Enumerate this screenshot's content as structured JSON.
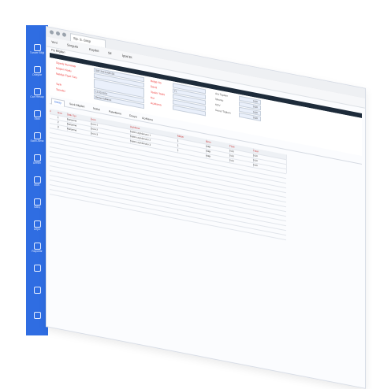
{
  "sidebar": {
    "items": [
      {
        "label": "Tuncer Bilgi",
        "icon": "home-icon"
      },
      {
        "label": "Onaylar",
        "icon": "tools-icon"
      },
      {
        "label": "Cari Hesap",
        "icon": "building-icon"
      },
      {
        "label": "Stok",
        "icon": "box-icon"
      },
      {
        "label": "Satın Alma",
        "icon": "cart-icon"
      },
      {
        "label": "Üretim",
        "icon": "gear-icon"
      },
      {
        "label": "Muh.",
        "icon": "doc-icon"
      },
      {
        "label": "Satış",
        "icon": "store-icon"
      },
      {
        "label": "Depo",
        "icon": "warehouse-icon"
      },
      {
        "label": "Raporlar",
        "icon": "chart-icon"
      },
      {
        "label": "",
        "icon": "truck-icon"
      },
      {
        "label": "",
        "icon": "car-icon"
      },
      {
        "label": "",
        "icon": "lock-icon"
      }
    ]
  },
  "window": {
    "tab_label": "Sip. S. Girişi",
    "toolbar": {
      "new": "Yeni",
      "query": "Sorgula",
      "save": "Kaydet",
      "delete": "Sil",
      "cancel": "İptal Et"
    },
    "section_title": "Fiş Bilgileri"
  },
  "form": {
    "left_labels": [
      "Sipariş Numarası",
      "Müşteri Kodu",
      "Nakliye Fiyat Türü",
      "Tarih",
      "Temsilci"
    ],
    "left_values": [
      "SAT-2024-000153",
      "",
      "",
      "12.03.2024",
      "Demo Kullanıcı"
    ],
    "mid_labels": [
      "Belge No",
      "Döviz",
      "Teslim Tarihi",
      "Kur",
      "Açıklama"
    ],
    "mid_values": [
      "",
      "TL",
      "",
      "",
      ""
    ],
    "right_labels": [
      "Ara Toplam",
      "İskonto",
      "KDV",
      "Genel Toplam"
    ],
    "right_values": [
      "0,00",
      "0,00",
      "0,00",
      "0,00"
    ]
  },
  "subtabs": [
    {
      "label": "Detay",
      "active": true
    },
    {
      "label": "Sevk Bilgileri",
      "active": false
    },
    {
      "label": "Notlar",
      "active": false
    },
    {
      "label": "Paketleme",
      "active": false
    },
    {
      "label": "Dosya",
      "active": false
    },
    {
      "label": "Açıklama",
      "active": false
    }
  ],
  "grid": {
    "columns": [
      "#",
      "Sıra",
      "Stok Tipi",
      "Ürün",
      "Açıklama",
      "Miktar",
      "Birim",
      "Fiyat",
      "Tutar"
    ],
    "rows": [
      [
        "",
        "1",
        "Malzeme",
        "Ürün-1",
        "Kalem açıklaması 1",
        "1",
        "Adet",
        "0,00",
        "0,00"
      ],
      [
        "",
        "2",
        "Malzeme",
        "Ürün-2",
        "Kalem açıklaması 2",
        "1",
        "Adet",
        "0,00",
        "0,00"
      ],
      [
        "",
        "3",
        "Malzeme",
        "Ürün-3",
        "Kalem açıklaması 3",
        "1",
        "Adet",
        "0,00",
        "0,00"
      ]
    ]
  }
}
